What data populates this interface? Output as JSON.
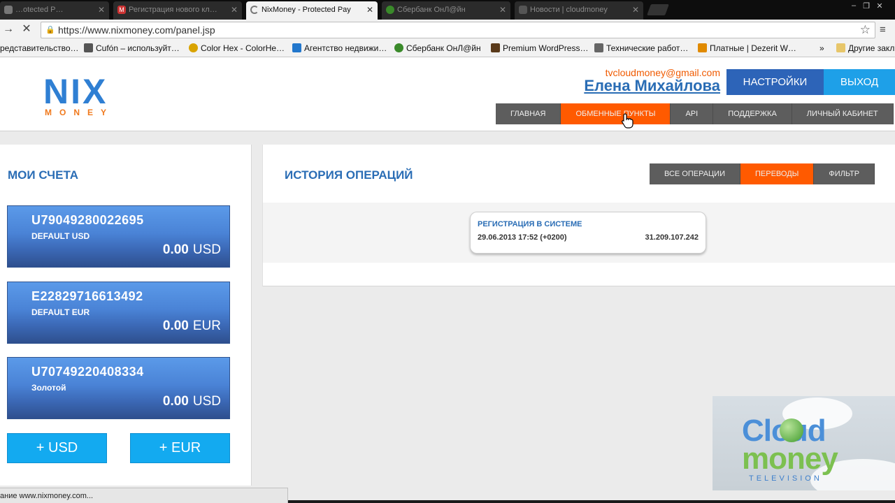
{
  "browser": {
    "tabs": [
      {
        "title": "…otected P…",
        "active": false
      },
      {
        "title": "Регистрация нового кл…",
        "active": false
      },
      {
        "title": "NixMoney - Protected Pay",
        "active": true
      },
      {
        "title": "Сбербанк ОнЛ@йн",
        "active": false
      },
      {
        "title": "Новости | cloudmoney",
        "active": false
      }
    ],
    "url": "https://www.nixmoney.com/panel.jsp",
    "bookmarks": [
      {
        "label": "редставительство…",
        "color": "#cc3333"
      },
      {
        "label": "Cufón – используйт…",
        "color": "#555555"
      },
      {
        "label": "Color Hex - ColorHe…",
        "color": "#d9a300"
      },
      {
        "label": "Агентство недвижи…",
        "color": "#2277cc"
      },
      {
        "label": "Сбербанк ОнЛ@йн",
        "color": "#3a8a2a"
      },
      {
        "label": "Premium WordPress…",
        "color": "#5a3a1a"
      },
      {
        "label": "Технические работ…",
        "color": "#666666"
      },
      {
        "label": "Платные | Dezerit W…",
        "color": "#e08a00"
      }
    ],
    "bookmarks_more": "»",
    "other_bookmarks": "Другие закл",
    "status_text": "ание www.nixmoney.com..."
  },
  "header": {
    "logo_top": "NIX",
    "logo_bottom": "MONEY",
    "email": "tvcloudmoney@gmail.com",
    "user_name": "Елена Михайлова",
    "settings_label": "НАСТРОЙКИ",
    "logout_label": "ВЫХОД",
    "nav": [
      {
        "label": "ГЛАВНАЯ",
        "active": false
      },
      {
        "label": "ОБМЕННЫЕ ПУНКТЫ",
        "active": true
      },
      {
        "label": "API",
        "active": false
      },
      {
        "label": "ПОДДЕРЖКА",
        "active": false
      },
      {
        "label": "ЛИЧНЫЙ КАБИНЕТ",
        "active": false
      }
    ]
  },
  "accounts": {
    "title": "МОИ СЧЕТА",
    "items": [
      {
        "number": "U79049280022695",
        "label": "DEFAULT USD",
        "amount": "0.00",
        "currency": "USD"
      },
      {
        "number": "E22829716613492",
        "label": "DEFAULT EUR",
        "amount": "0.00",
        "currency": "EUR"
      },
      {
        "number": "U70749220408334",
        "label": "Золотой",
        "amount": "0.00",
        "currency": "USD"
      }
    ],
    "add_usd": "+ USD",
    "add_eur": "+ EUR"
  },
  "history": {
    "title": "ИСТОРИЯ ОПЕРАЦИЙ",
    "filters": [
      {
        "label": "ВСЕ ОПЕРАЦИИ",
        "active": false
      },
      {
        "label": "ПЕРЕВОДЫ",
        "active": true
      },
      {
        "label": "ФИЛЬТР",
        "active": false
      }
    ],
    "operations": [
      {
        "title": "РЕГИСТРАЦИЯ В СИСТЕМЕ",
        "date": "29.06.2013 17:52 (+0200)",
        "ip": "31.209.107.242"
      }
    ]
  },
  "watermark": {
    "line1": "Cloud",
    "line2": "money",
    "line3": "TELEVISION"
  },
  "colors": {
    "accent_orange": "#ff5a00",
    "brand_blue": "#2a6db5",
    "button_blue": "#2d64b8",
    "button_light_blue": "#1ea0e8"
  }
}
